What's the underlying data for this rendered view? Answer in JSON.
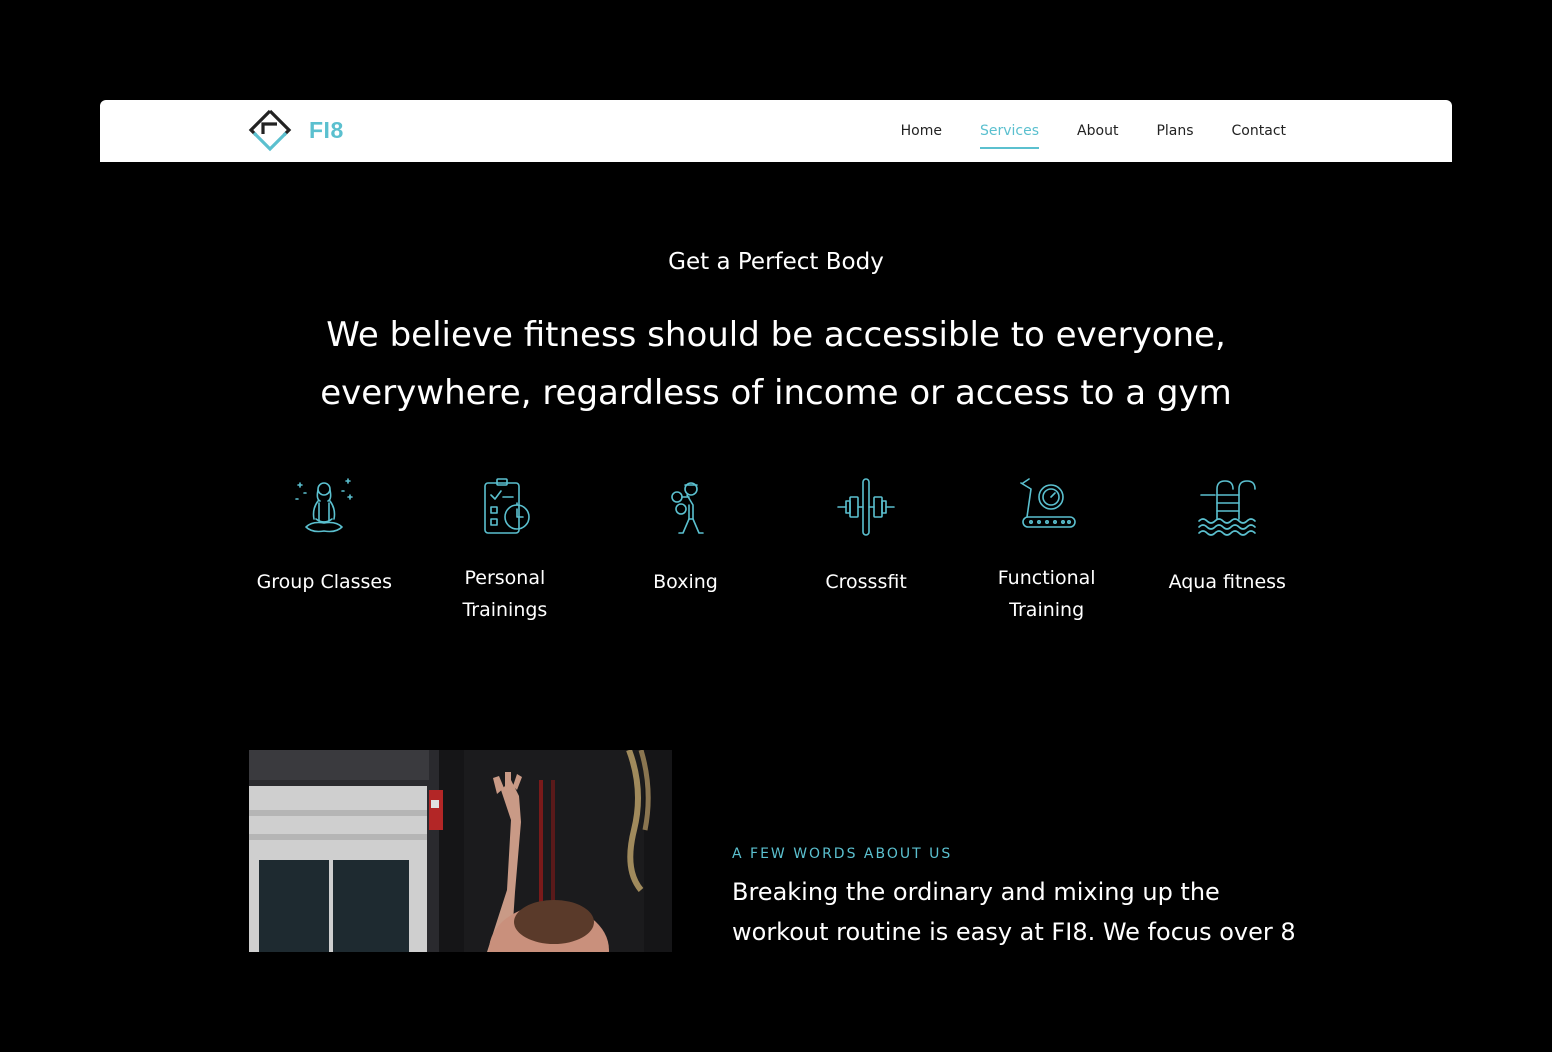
{
  "brand": {
    "name": "FI8"
  },
  "nav": {
    "items": [
      "Home",
      "Services",
      "About",
      "Plans",
      "Contact"
    ],
    "active": "Services"
  },
  "hero": {
    "tagline": "Get a Perfect Body",
    "headline": "We believe fitness should be accessible to everyone, everywhere, regardless of income or access to a gym"
  },
  "services": [
    {
      "label": "Group Classes",
      "icon": "meditation-icon"
    },
    {
      "label": "Personal Trainings",
      "icon": "clipboard-timer-icon"
    },
    {
      "label": "Boxing",
      "icon": "boxer-icon"
    },
    {
      "label": "Crosssfit",
      "icon": "barbell-icon"
    },
    {
      "label": "Functional Training",
      "icon": "treadmill-icon"
    },
    {
      "label": "Aqua fitness",
      "icon": "pool-icon"
    }
  ],
  "about": {
    "eyebrow": "A FEW WORDS ABOUT US",
    "text": "Breaking the ordinary and mixing up the workout routine is easy at FI8. We focus over 8"
  },
  "colors": {
    "accent": "#5bc0cf",
    "background": "#000000",
    "navbar": "#ffffff"
  }
}
